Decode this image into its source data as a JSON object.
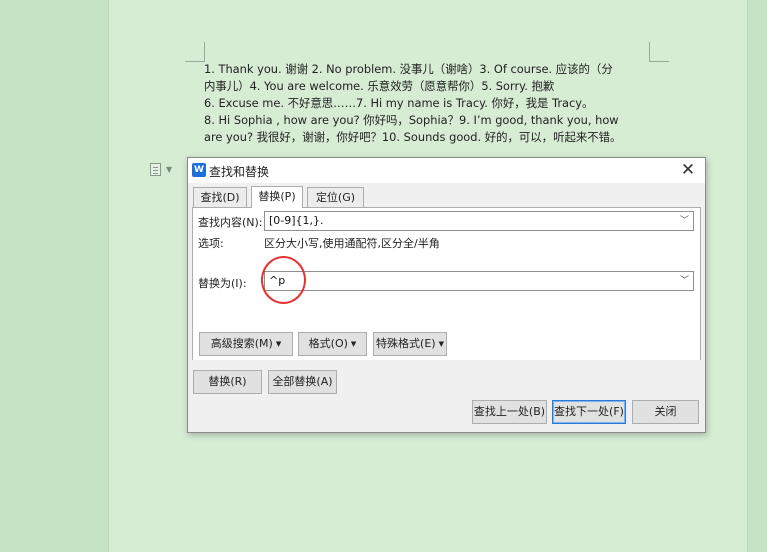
{
  "document": {
    "lines": [
      "1.     Thank you. 谢谢 2.       No problem. 没事儿（谢啥）3.       Of course. 应该的（分",
      "内事儿）4.          You are welcome. 乐意效劳（愿意帮你）5.         Sorry. 抱歉",
      "6.        Excuse me. 不好意思……7.        Hi my name is Tracy. 你好，我是 Tracy。",
      "8.        Hi Sophia , how are you? 你好吗，Sophia？9.        I’m good, thank you, how",
      "are you? 我很好，谢谢，你好吧？10.    Sounds good. 好的，可以，听起来不错。"
    ]
  },
  "dialog": {
    "title": "查找和替换",
    "app_icon_glyph": "W",
    "close_glyph": "✕",
    "tabs": [
      {
        "label": "查找(D)",
        "active": false
      },
      {
        "label": "替换(P)",
        "active": true
      },
      {
        "label": "定位(G)",
        "active": false
      }
    ],
    "find": {
      "label": "查找内容(N):",
      "value": "[0-9]{1,}."
    },
    "options": {
      "label": "选项:",
      "value": "区分大小写,使用通配符,区分全/半角"
    },
    "replace": {
      "label": "替换为(I):",
      "value": "^p"
    },
    "advanced_buttons": {
      "advanced_search": "高级搜索(M)",
      "format": "格式(O)",
      "special_format": "特殊格式(E)"
    },
    "replace_buttons": {
      "replace": "替换(R)",
      "replace_all": "全部替换(A)"
    },
    "nav_buttons": {
      "find_prev": "查找上一处(B)",
      "find_next": "查找下一处(F)",
      "close": "关闭"
    }
  },
  "colors": {
    "background": "#c7e3c6",
    "page": "#d6ecd3",
    "accent": "#2a7ad8",
    "annotation": "#e53232"
  }
}
